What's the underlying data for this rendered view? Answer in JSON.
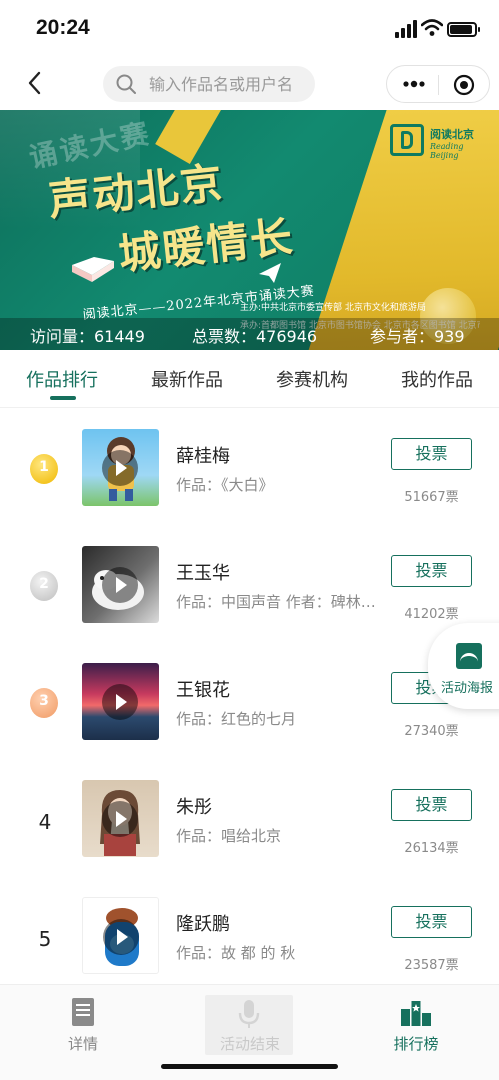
{
  "status_bar": {
    "time": "20:24"
  },
  "nav": {
    "search_placeholder": "输入作品名或用户名"
  },
  "banner": {
    "recite": "诵读大赛",
    "title_line1": "声动北京",
    "title_line2": "城暖情长",
    "subtitle": "阅读北京——2022年北京市诵读大赛",
    "logo_title": "阅读北京",
    "logo_sub": "Reading Beijing",
    "host": "主办:中共北京市委宣传部  北京市文化和旅游局",
    "organizer": "承办:首都图书馆  北京市图书馆协会  北京市各区图书馆  北京市图书馆文化志愿服务中心",
    "stats": {
      "visits": "访问量：61449",
      "votes": "总票数：476946",
      "participants": "参与者：939"
    }
  },
  "tabs": [
    {
      "label": "作品排行",
      "active": true
    },
    {
      "label": "最新作品",
      "active": false
    },
    {
      "label": "参赛机构",
      "active": false
    },
    {
      "label": "我的作品",
      "active": false
    }
  ],
  "entries": [
    {
      "rank": "1",
      "medal": "gold",
      "name": "薛桂梅",
      "work": "作品：《大白》",
      "vote_label": "投票",
      "votes": "51667票"
    },
    {
      "rank": "2",
      "medal": "silver",
      "name": "王玉华",
      "work": "作品：中国声音 作者：碑林…",
      "vote_label": "投票",
      "votes": "41202票"
    },
    {
      "rank": "3",
      "medal": "bronze",
      "name": "王银花",
      "work": "作品：红色的七月",
      "vote_label": "投票",
      "votes": "27340票"
    },
    {
      "rank": "4",
      "medal": "",
      "name": "朱彤",
      "work": "作品：唱给北京",
      "vote_label": "投票",
      "votes": "26134票"
    },
    {
      "rank": "5",
      "medal": "",
      "name": "隆跃鹏",
      "work": "作品：故 都 的 秋",
      "vote_label": "投票",
      "votes": "23587票"
    }
  ],
  "poster": {
    "label": "活动海报"
  },
  "bottom_nav": [
    {
      "label": "详情",
      "icon": "document-icon"
    },
    {
      "label": "活动结束",
      "icon": "microphone-icon"
    },
    {
      "label": "排行榜",
      "icon": "ranking-icon"
    }
  ],
  "colors": {
    "accent": "#16705d",
    "banner_green": "#0f7a61",
    "banner_gold": "#e9c63a"
  }
}
